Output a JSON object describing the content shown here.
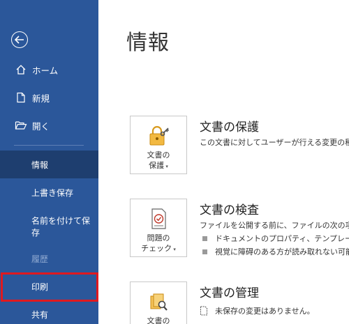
{
  "sidebar": {
    "back_label": "",
    "items": [
      {
        "label": "ホーム"
      },
      {
        "label": "新規"
      },
      {
        "label": "開く"
      },
      {
        "label": "情報"
      },
      {
        "label": "上書き保存"
      },
      {
        "label": "名前を付けて保存"
      },
      {
        "label": "履歴"
      },
      {
        "label": "印刷"
      },
      {
        "label": "共有"
      }
    ]
  },
  "main": {
    "title": "情報",
    "protect": {
      "tile_line1": "文書の",
      "tile_line2": "保護",
      "title": "文書の保護",
      "desc": "この文書に対してユーザーが行える変更の種類"
    },
    "inspect": {
      "tile_line1": "問題の",
      "tile_line2": "チェック",
      "title": "文書の検査",
      "desc": "ファイルを公開する前に、ファイルの次の項目を",
      "bullets": [
        "ドキュメントのプロパティ、テンプレート名、作",
        "視覚に障碍のある方が読み取れない可能"
      ]
    },
    "manage": {
      "tile_line1": "文書の",
      "title": "文書の管理",
      "desc": "未保存の変更はありません。"
    }
  },
  "colors": {
    "sidebar_bg": "#2B579A",
    "active_bg": "#1E3E6F",
    "highlight_border": "#E0191F"
  }
}
